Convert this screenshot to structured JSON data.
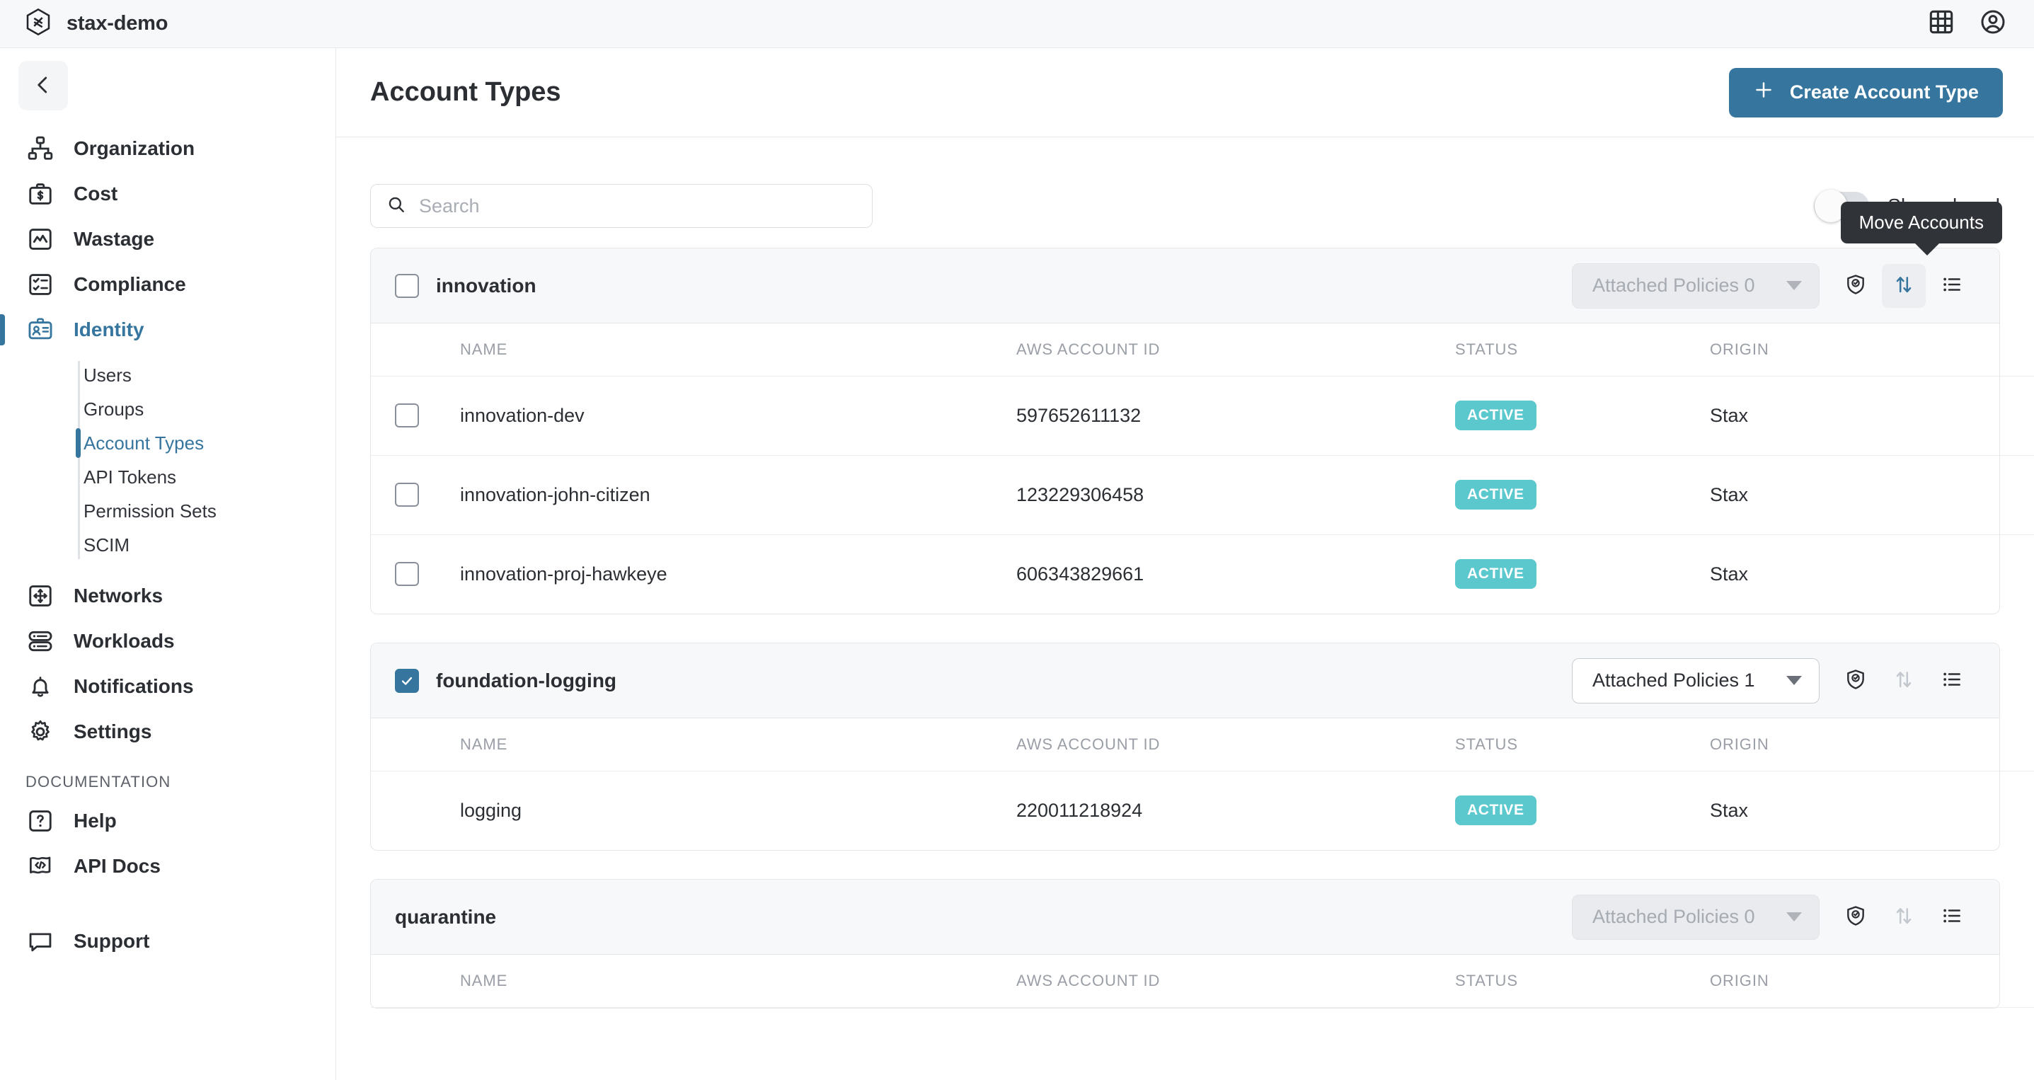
{
  "topbar": {
    "brand_name": "stax-demo",
    "logo_icon": "stax-hexagon-logo",
    "apps_icon": "grid-apps-icon",
    "account_icon": "user-circle-icon"
  },
  "sidebar": {
    "collapse_icon": "chevron-left-icon",
    "items": [
      {
        "label": "Organization",
        "icon": "org-chart-icon",
        "active": false
      },
      {
        "label": "Cost",
        "icon": "briefcase-dollar-icon",
        "active": false
      },
      {
        "label": "Wastage",
        "icon": "chart-line-icon",
        "active": false
      },
      {
        "label": "Compliance",
        "icon": "checklist-icon",
        "active": false
      },
      {
        "label": "Identity",
        "icon": "id-badge-icon",
        "active": true
      }
    ],
    "subitems": [
      {
        "label": "Users",
        "active": false
      },
      {
        "label": "Groups",
        "active": false
      },
      {
        "label": "Account Types",
        "active": true
      },
      {
        "label": "API Tokens",
        "active": false
      },
      {
        "label": "Permission Sets",
        "active": false
      },
      {
        "label": "SCIM",
        "active": false
      }
    ],
    "items_lower": [
      {
        "label": "Networks",
        "icon": "move-arrows-box-icon"
      },
      {
        "label": "Workloads",
        "icon": "server-stack-icon"
      },
      {
        "label": "Notifications",
        "icon": "bell-icon"
      },
      {
        "label": "Settings",
        "icon": "gear-icon"
      }
    ],
    "section_label": "DOCUMENTATION",
    "docs_items": [
      {
        "label": "Help",
        "icon": "question-box-icon"
      },
      {
        "label": "API Docs",
        "icon": "code-flag-icon"
      }
    ],
    "support": {
      "label": "Support",
      "icon": "chat-bubble-icon"
    }
  },
  "header": {
    "title": "Account Types",
    "create_button_label": "Create Account Type",
    "create_button_icon": "plus-icon",
    "accent_color": "#36769e"
  },
  "toolbar": {
    "search_placeholder": "Search",
    "search_value": "",
    "search_icon": "search-icon",
    "show_closed_label": "Show closed",
    "show_closed_on": false
  },
  "tooltip": {
    "text": "Move Accounts"
  },
  "columns": [
    "NAME",
    "AWS ACCOUNT ID",
    "STATUS",
    "ORIGIN"
  ],
  "row_action_icons": [
    "star-icon",
    "sign-in-circle-icon",
    "kebab-menu-icon"
  ],
  "group_action_icons": [
    "shield-check-icon",
    "move-accounts-icon",
    "list-icon"
  ],
  "status_color": "#5bc8cd",
  "groups": [
    {
      "name": "innovation",
      "checkbox": "unchecked",
      "policies_label": "Attached Policies 0",
      "policies_enabled": false,
      "move_enabled": true,
      "move_hovered": true,
      "rows": [
        {
          "checkbox": "unchecked",
          "name": "innovation-dev",
          "account_id": "597652611132",
          "status": "ACTIVE",
          "origin": "Stax"
        },
        {
          "checkbox": "unchecked",
          "name": "innovation-john-citizen",
          "account_id": "123229306458",
          "status": "ACTIVE",
          "origin": "Stax"
        },
        {
          "checkbox": "unchecked",
          "name": "innovation-proj-hawkeye",
          "account_id": "606343829661",
          "status": "ACTIVE",
          "origin": "Stax"
        }
      ]
    },
    {
      "name": "foundation-logging",
      "checkbox": "checked",
      "policies_label": "Attached Policies 1",
      "policies_enabled": true,
      "move_enabled": false,
      "move_hovered": false,
      "rows": [
        {
          "checkbox": "none",
          "name": "logging",
          "account_id": "220011218924",
          "status": "ACTIVE",
          "origin": "Stax"
        }
      ]
    },
    {
      "name": "quarantine",
      "checkbox": "none",
      "policies_label": "Attached Policies 0",
      "policies_enabled": false,
      "move_enabled": false,
      "move_hovered": false,
      "rows": []
    }
  ]
}
